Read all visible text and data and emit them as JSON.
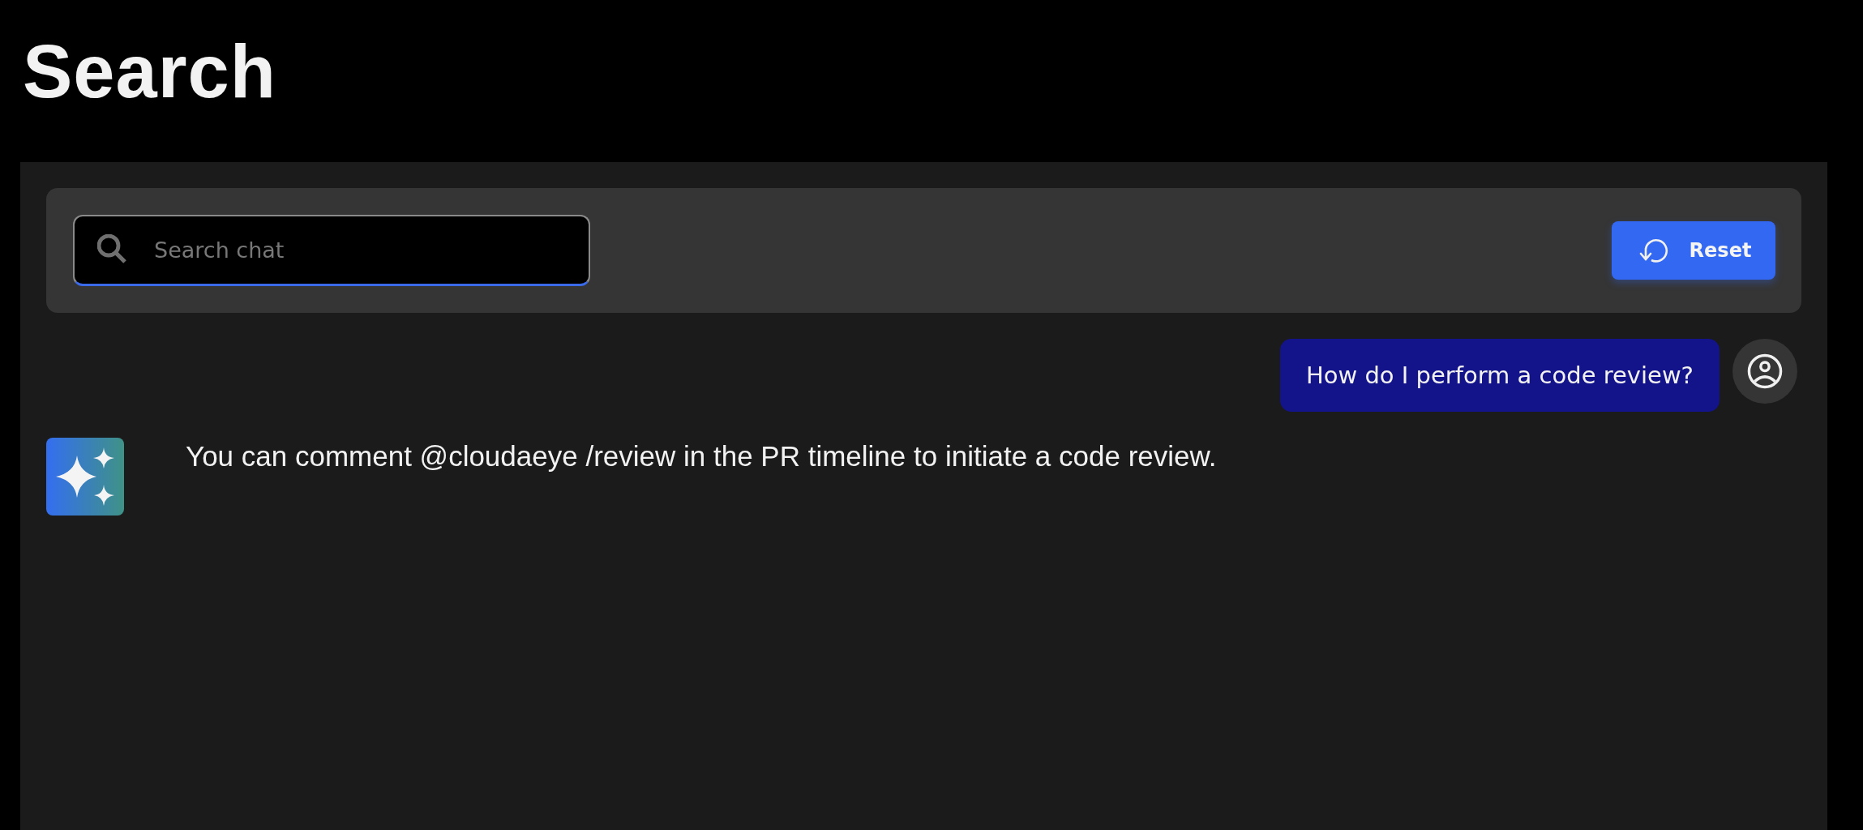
{
  "page": {
    "title": "Search"
  },
  "search": {
    "placeholder": "Search chat"
  },
  "reset_button": {
    "label": "Reset"
  },
  "messages": [
    {
      "kind": "user",
      "text": "How do I perform a code review?"
    },
    {
      "kind": "assistant",
      "text": "You can comment @cloudaeye /review in the PR timeline to initiate a code review."
    }
  ]
}
